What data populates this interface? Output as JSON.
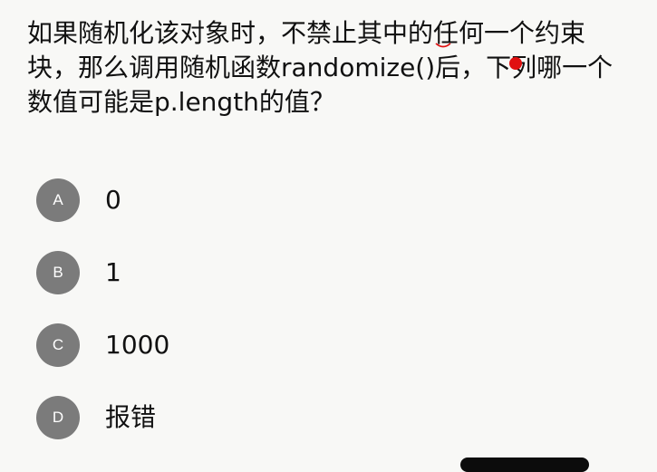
{
  "question": {
    "text": "如果随机化该对象时，不禁止其中的任何一个约束块，那么调用随机函数randomize()后，下列哪一个数值可能是p.length的值？"
  },
  "options": [
    {
      "badge": "A",
      "text": "0"
    },
    {
      "badge": "B",
      "text": "1"
    },
    {
      "badge": "C",
      "text": "1000"
    },
    {
      "badge": "D",
      "text": "报错"
    }
  ],
  "colors": {
    "badge_bg": "#7b7b7b",
    "annotation_red": "#e01010",
    "background": "#f8f8f6"
  }
}
